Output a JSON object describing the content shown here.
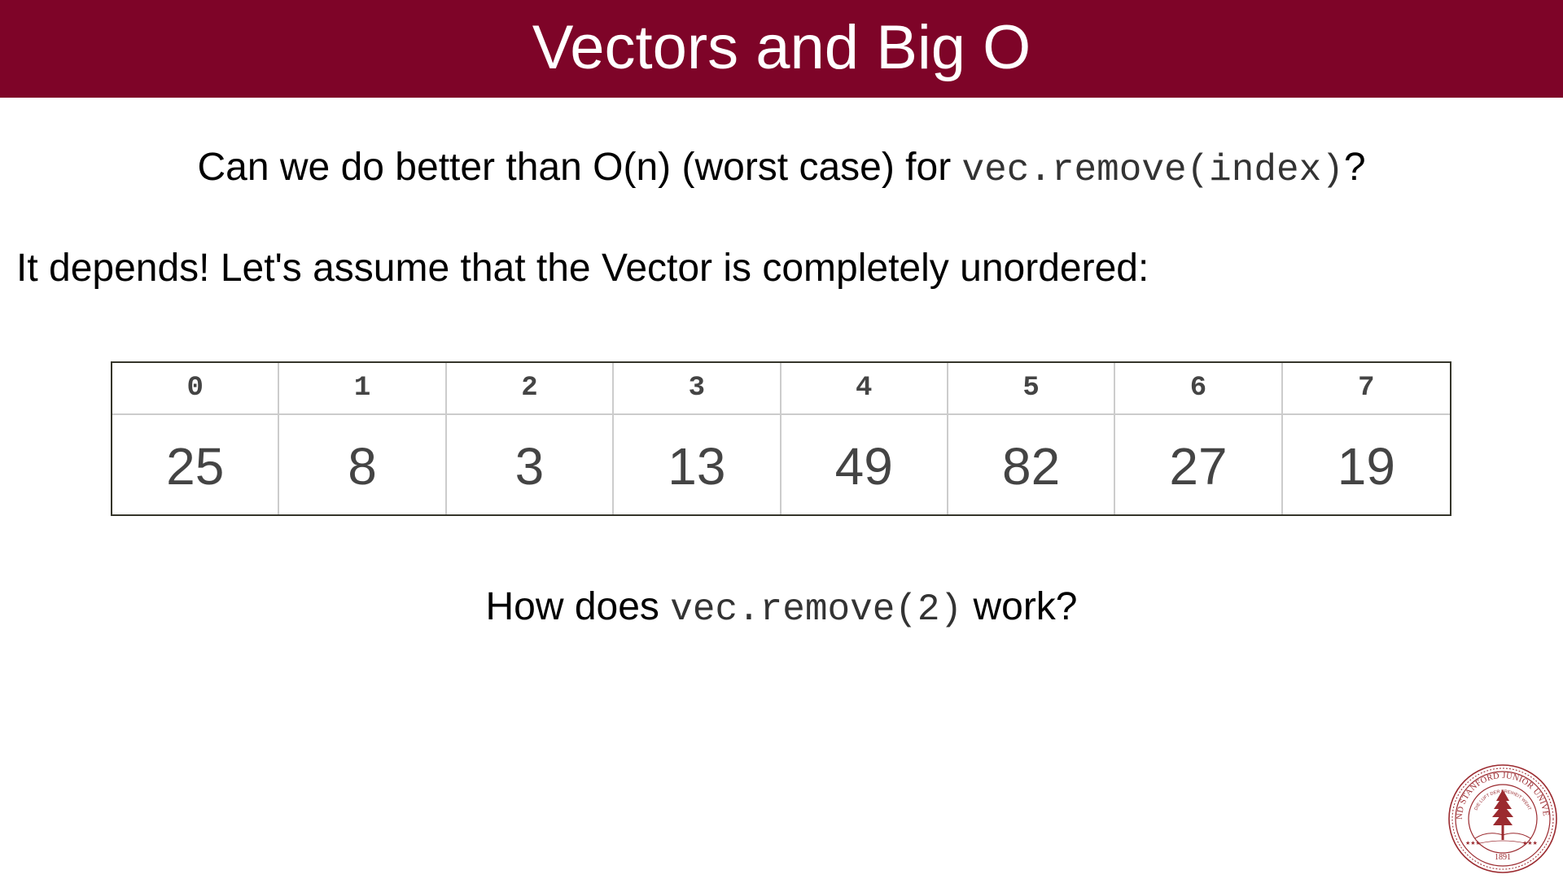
{
  "slide": {
    "title": "Vectors and Big O",
    "question": {
      "text_before": "Can we do better than O(n) (worst case) for ",
      "code": "vec.remove(index)",
      "text_after": "?"
    },
    "statement": "It depends! Let's assume that the Vector is completely unordered:",
    "vector": {
      "indices": [
        "0",
        "1",
        "2",
        "3",
        "4",
        "5",
        "6",
        "7"
      ],
      "values": [
        "25",
        "8",
        "3",
        "13",
        "49",
        "82",
        "27",
        "19"
      ]
    },
    "followup": {
      "text_before": "How does ",
      "code": "vec.remove(2)",
      "text_after": " work?"
    },
    "logo": {
      "icon": "stanford-seal-icon",
      "ring_text": "LELAND STANFORD JUNIOR UNIVERSITY",
      "motto": "DIE LUFT DER FREIHEIT WEHT",
      "year": "1891"
    },
    "colors": {
      "title_bar": "#7e0428",
      "seal": "#9b2a2f",
      "cell_text": "#444444"
    }
  }
}
